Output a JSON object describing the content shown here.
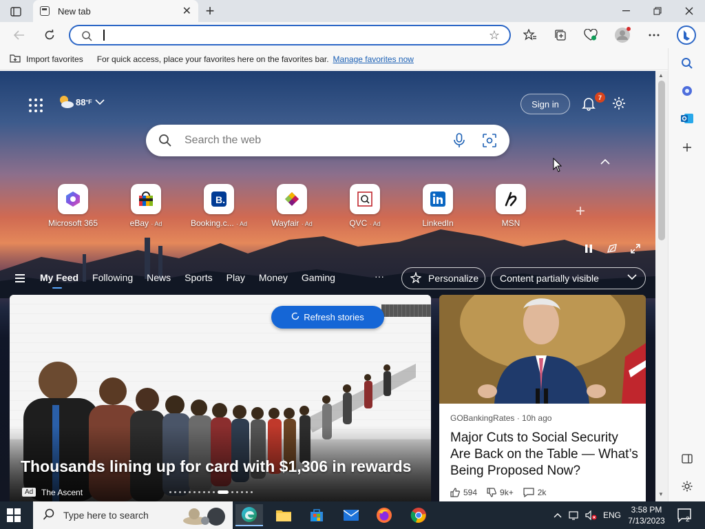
{
  "browser": {
    "tab_title": "New tab",
    "address_value": "",
    "favorites_bar": {
      "import_label": "Import favorites",
      "hint": "For quick access, place your favorites here on the favorites bar.",
      "manage_link": "Manage favorites now"
    }
  },
  "page": {
    "weather_temp": "88",
    "weather_unit": "°F",
    "sign_in": "Sign in",
    "notification_count": "7",
    "search_placeholder": "Search the web",
    "tiles": [
      {
        "label": "Microsoft 365",
        "ad": ""
      },
      {
        "label": "eBay",
        "ad": "· Ad"
      },
      {
        "label": "Booking.c...",
        "ad": "· Ad"
      },
      {
        "label": "Wayfair",
        "ad": "· Ad"
      },
      {
        "label": "QVC",
        "ad": "· Ad"
      },
      {
        "label": "LinkedIn",
        "ad": ""
      },
      {
        "label": "MSN",
        "ad": ""
      }
    ],
    "feed_tabs": [
      "My Feed",
      "Following",
      "News",
      "Sports",
      "Play",
      "Money",
      "Gaming"
    ],
    "more": "···",
    "personalize": "Personalize",
    "content_visibility": "Content partially visible",
    "refresh": "Refresh stories",
    "hero": {
      "headline": "Thousands lining up for card with $1,306 in rewards",
      "ad_badge": "Ad",
      "source": "The Ascent"
    },
    "side_story": {
      "source": "GOBankingRates · 10h ago",
      "title": "Major Cuts to Social Security Are Back on the Table — What’s Being Proposed Now?",
      "likes": "594",
      "dislikes": "9k+",
      "comments": "2k"
    }
  },
  "taskbar": {
    "search_placeholder": "Type here to search",
    "language": "ENG",
    "time": "3:58 PM",
    "date": "7/13/2023",
    "notification_count": "2"
  }
}
